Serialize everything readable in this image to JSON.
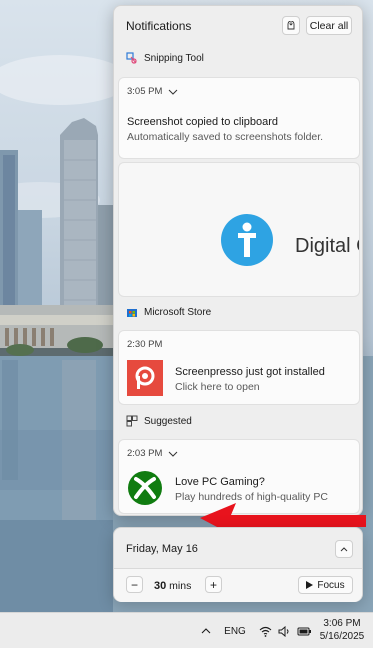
{
  "panel": {
    "title": "Notifications",
    "clear_all_label": "Clear all",
    "groups": [
      {
        "app": "Snipping Tool",
        "time": "3:05 PM",
        "title": "Screenshot copied to clipboard",
        "subtitle": "Automatically saved to screenshots folder.",
        "banner_text": "Digital C"
      },
      {
        "app": "Microsoft Store",
        "time": "2:30 PM",
        "title": "Screenpresso just got installed",
        "subtitle": "Click here to open"
      },
      {
        "app": "Suggested",
        "time": "2:03 PM",
        "title": "Love PC Gaming?",
        "subtitle": "Play hundreds of high-quality PC"
      }
    ]
  },
  "calendar": {
    "date": "Friday, May 16",
    "focus_minutes": "30",
    "focus_unit": "mins",
    "focus_label": "Focus",
    "minus_label": "−",
    "plus_label": "+"
  },
  "taskbar": {
    "language": "ENG",
    "time": "3:06 PM",
    "date": "5/16/2025"
  },
  "colors": {
    "arrow": "#e8131d",
    "screenpresso": "#e64a3e",
    "xbox": "#107c10",
    "digital_citizen": "#2ea3e3"
  },
  "icons": [
    "dnd-icon",
    "snipping-tool-icon",
    "microsoft-store-icon",
    "suggested-icon",
    "chevron-down-icon",
    "chevron-up-icon",
    "play-icon",
    "chevron-up-tray-icon",
    "wifi-icon",
    "speaker-icon",
    "battery-icon"
  ]
}
